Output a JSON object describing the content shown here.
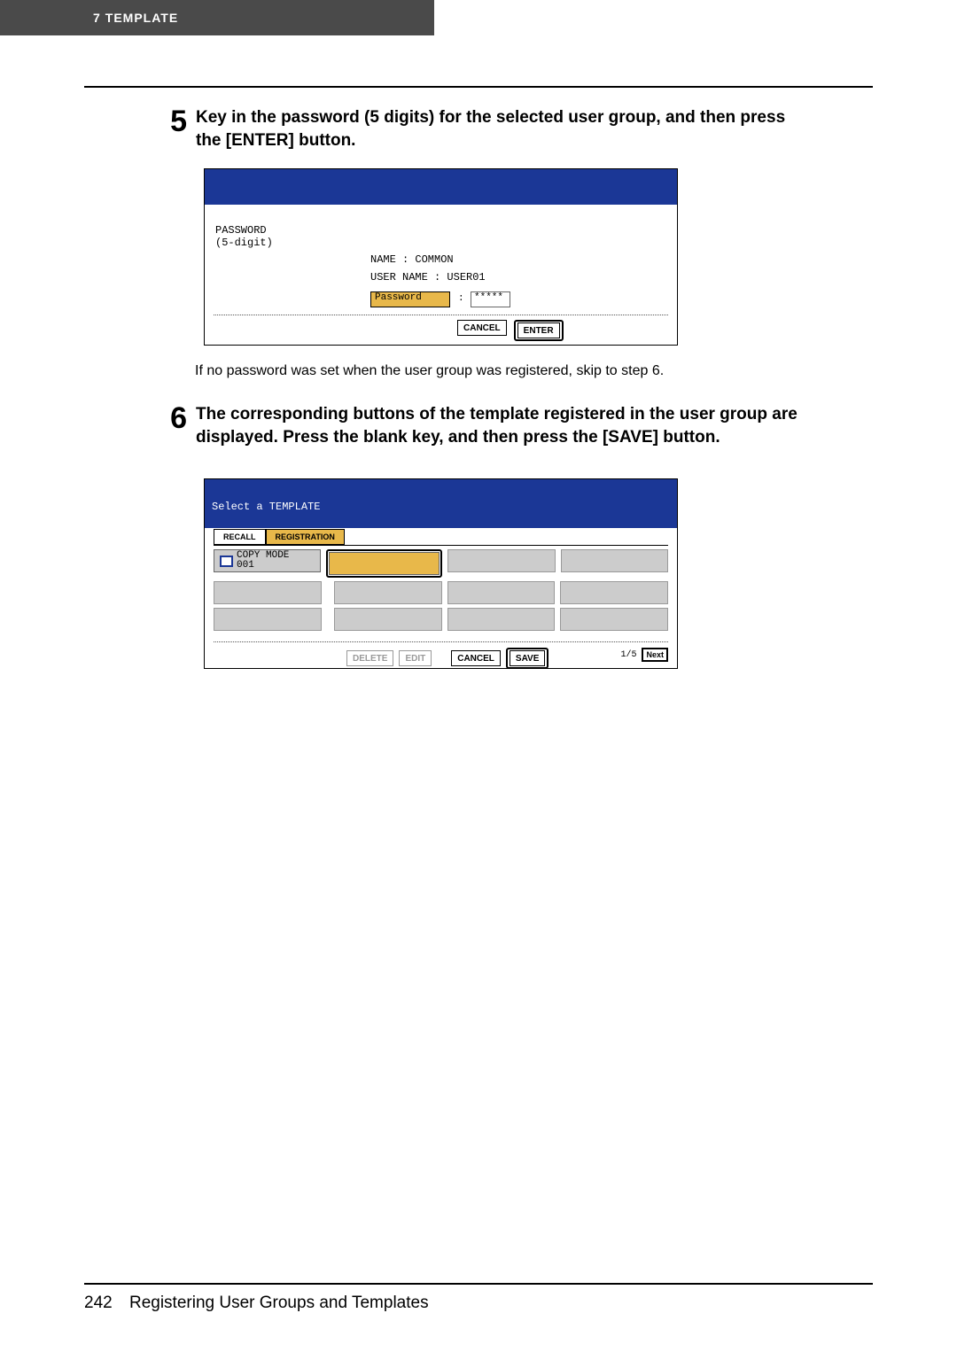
{
  "header": {
    "num": "7",
    "title": "TEMPLATE"
  },
  "steps": {
    "s5": {
      "num": "5",
      "text": "Key in the password (5 digits) for the selected user group, and then press the [ENTER] button."
    },
    "note5": "If no password was set when the user group was registered, skip to step 6.",
    "s6": {
      "num": "6",
      "text": "The corresponding buttons of the template registered in the user group are displayed. Press the blank key, and then press the [SAVE] button."
    }
  },
  "panel1": {
    "passLabel": "PASSWORD\n(5-digit)",
    "name": "NAME      : COMMON",
    "user": "USER NAME : USER01",
    "pwBtn": "Password",
    "pwColon": ":",
    "pwVal": "*****",
    "cancel": "CANCEL",
    "enter": "ENTER"
  },
  "panel2": {
    "title": "Select a TEMPLATE",
    "tabRecall": "RECALL",
    "tabReg": "REGISTRATION",
    "tpl1": "COPY MODE",
    "tpl1n": "001",
    "del": "DELETE",
    "edit": "EDIT",
    "cancel": "CANCEL",
    "save": "SAVE",
    "page": "1/5",
    "next": "Next"
  },
  "footer": {
    "page": "242",
    "title": "Registering User Groups and Templates"
  }
}
